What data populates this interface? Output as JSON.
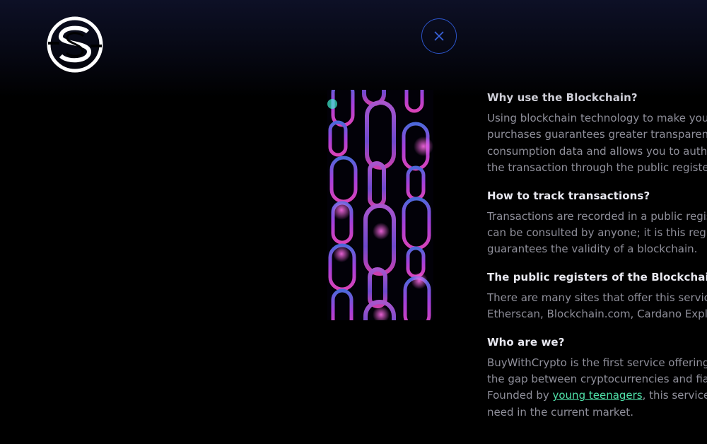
{
  "header": {
    "logo_icon": "s-coin-logo-icon",
    "close_icon": "close-x-icon",
    "accent_color": "#2c54c8"
  },
  "image": {
    "icon": "chain-links-illustration",
    "colors": [
      "#c24bff",
      "#ff4fd8",
      "#5a7cff",
      "#3ef0d0"
    ]
  },
  "faq": [
    {
      "question": "Why use the Blockchain?",
      "answer_lines": [
        "Using blockchain technology to make you",
        "purchases guarantees greater transparenc",
        "consumption data and allows you to authe",
        "the transaction through the public registe"
      ]
    },
    {
      "question": "How to track transactions?",
      "answer_lines": [
        "Transactions are recorded in a public regis",
        "can be consulted by anyone; it is this regis",
        "guarantees the validity of a blockchain."
      ]
    },
    {
      "question": "The public registers of the Blockchain.",
      "answer_lines": [
        "There are many sites that offer this service",
        "Etherscan, Blockchain.com, Cardano Explo"
      ]
    },
    {
      "question": "Who are we?",
      "answer_lines": [
        "BuyWithCrypto is the first service offering",
        "the gap between cryptocurrencies and fiat"
      ],
      "founded_prefix": "Founded by ",
      "founded_link": "young teenagers",
      "founded_suffix": ", this service f",
      "last_line": "need in the current market."
    }
  ],
  "link_color": "#4fe0a8"
}
